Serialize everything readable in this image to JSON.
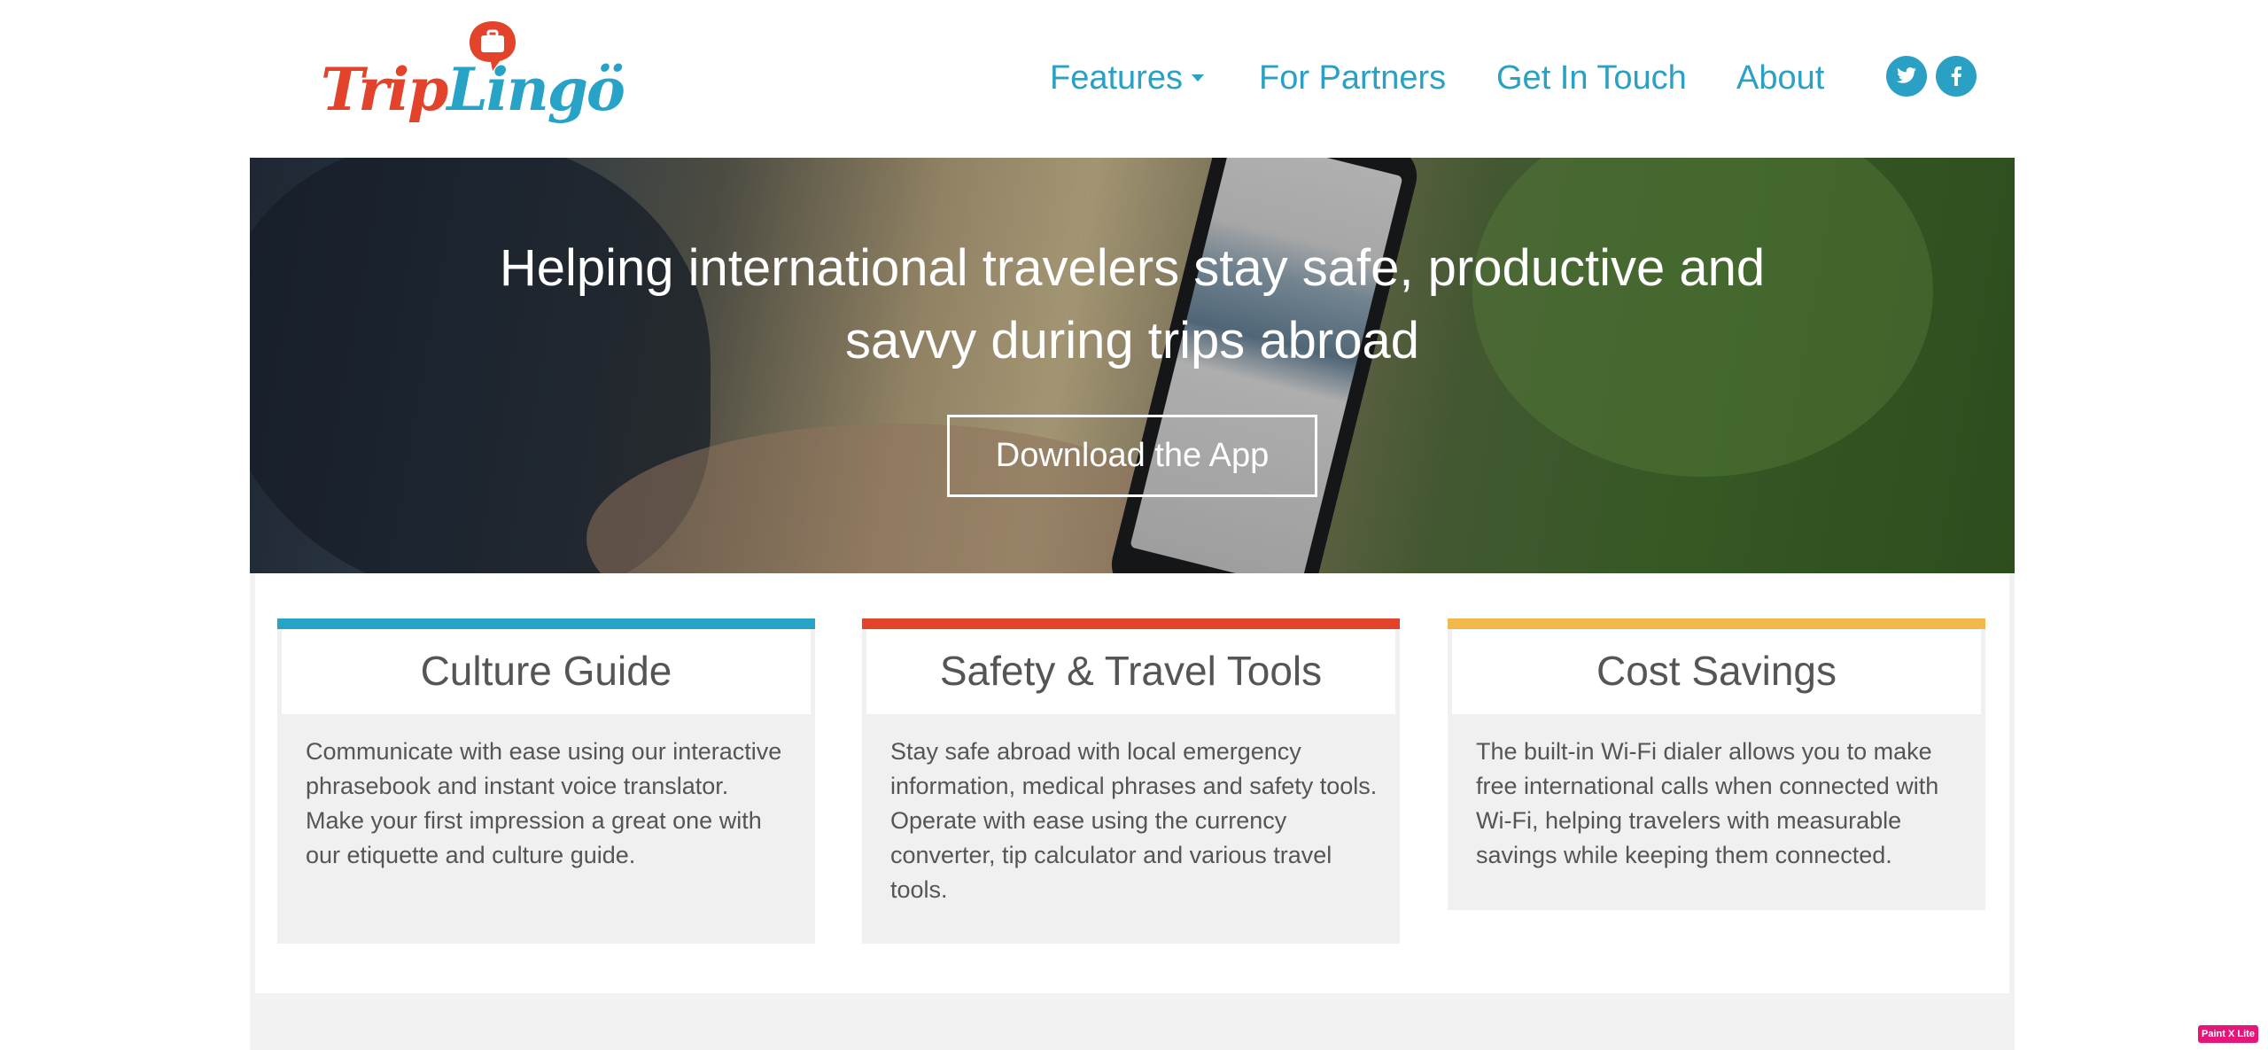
{
  "brand": {
    "logo_part1": "Trip",
    "logo_part2": "Lingö",
    "primary_color": "#2aa1c4",
    "red_color": "#e2432a",
    "yellow_color": "#f2b84b"
  },
  "nav": {
    "items": [
      {
        "label": "Features",
        "has_dropdown": true
      },
      {
        "label": "For Partners"
      },
      {
        "label": "Get In Touch"
      },
      {
        "label": "About"
      }
    ],
    "social": [
      {
        "icon": "twitter-icon"
      },
      {
        "icon": "facebook-icon"
      }
    ]
  },
  "hero": {
    "title": "Helping international travelers stay safe, productive and savvy during trips abroad",
    "cta_label": "Download the App"
  },
  "cards": [
    {
      "title": "Culture Guide",
      "accent": "#27a3c8",
      "body": "Communicate with ease using our interactive phrasebook and instant voice translator. Make your first impression a great one with our etiquette and culture guide."
    },
    {
      "title": "Safety & Travel Tools",
      "accent": "#e2432a",
      "body": "Stay safe abroad with local emergency information, medical phrases and safety tools. Operate with ease using the currency converter, tip calculator and various travel tools."
    },
    {
      "title": "Cost Savings",
      "accent": "#f2b84b",
      "body": "The built-in Wi-Fi dialer allows you to make free international calls when connected with Wi-Fi, helping travelers with measurable savings while keeping them connected."
    }
  ],
  "badge": {
    "label": "Paint X Lite"
  }
}
